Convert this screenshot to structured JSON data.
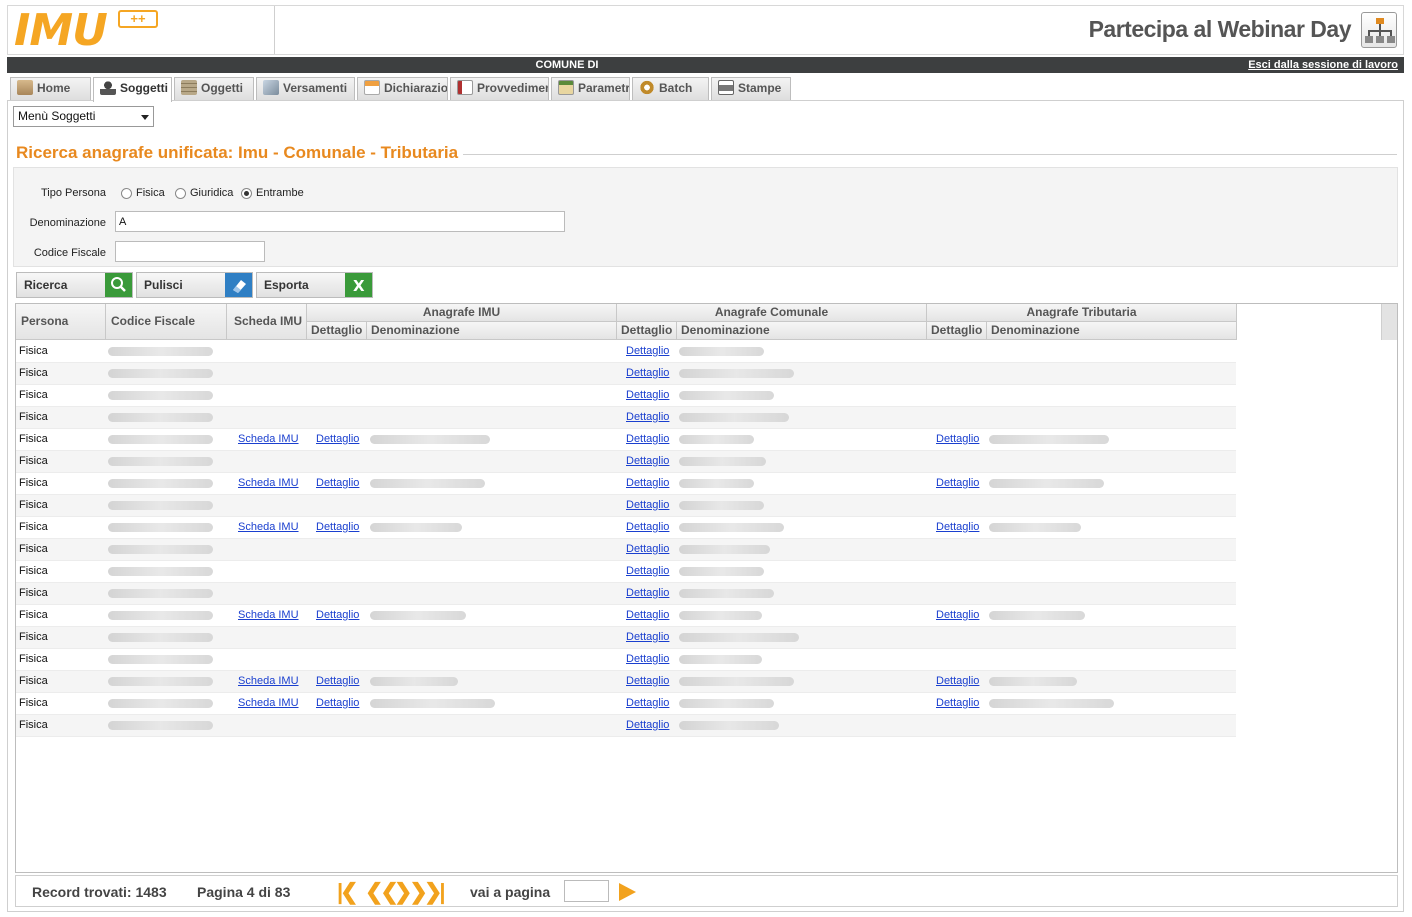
{
  "header": {
    "logo_text": "IMU",
    "logo_badge": "++",
    "webinar_text": "Partecipa al Webinar Day"
  },
  "topbar": {
    "comune": "COMUNE DI",
    "logout": "Esci dalla sessione di lavoro"
  },
  "tabs": [
    {
      "label": "Home",
      "icon": "home-icon",
      "color": "#8a6d3b"
    },
    {
      "label": "Soggetti",
      "icon": "user-icon",
      "color": "#444444"
    },
    {
      "label": "Oggetti",
      "icon": "building-icon",
      "color": "#9a8a6a"
    },
    {
      "label": "Versamenti",
      "icon": "payment-icon",
      "color": "#7b8c9c"
    },
    {
      "label": "Dichiarazio",
      "icon": "declaration-icon",
      "color": "#d9822b"
    },
    {
      "label": "Provvedimen",
      "icon": "document-icon",
      "color": "#b03030"
    },
    {
      "label": "Parametr",
      "icon": "parameters-icon",
      "color": "#c0782a"
    },
    {
      "label": "Batch",
      "icon": "gears-icon",
      "color": "#c08a2a"
    },
    {
      "label": "Stampe",
      "icon": "printer-icon",
      "color": "#666666"
    }
  ],
  "active_tab": "Soggetti",
  "menu": {
    "selected": "Menù Soggetti"
  },
  "section": {
    "title": "Ricerca anagrafe unificata: Imu - Comunale - Tributaria"
  },
  "form": {
    "tipo_persona_label": "Tipo Persona",
    "options": [
      "Fisica",
      "Giuridica",
      "Entrambe"
    ],
    "selected_option": "Entrambe",
    "denominazione_label": "Denominazione",
    "denominazione_value": "A",
    "codice_fiscale_label": "Codice Fiscale",
    "codice_fiscale_value": ""
  },
  "buttons": {
    "ricerca": "Ricerca",
    "pulisci": "Pulisci",
    "esporta": "Esporta"
  },
  "grid": {
    "headers": {
      "persona": "Persona",
      "codice_fiscale": "Codice Fiscale",
      "scheda_imu": "Scheda IMU",
      "anagrafe_imu": "Anagrafe IMU",
      "anagrafe_comunale": "Anagrafe Comunale",
      "anagrafe_tributaria": "Anagrafe Tributaria",
      "dettaglio": "Dettaglio",
      "denominazione": "Denominazione"
    },
    "link_scheda": "Scheda IMU",
    "link_dettaglio": "Dettaglio",
    "rows": [
      {
        "persona": "Fisica",
        "imu": false,
        "trib": false
      },
      {
        "persona": "Fisica",
        "imu": false,
        "trib": false
      },
      {
        "persona": "Fisica",
        "imu": false,
        "trib": false
      },
      {
        "persona": "Fisica",
        "imu": false,
        "trib": false
      },
      {
        "persona": "Fisica",
        "imu": true,
        "trib": true
      },
      {
        "persona": "Fisica",
        "imu": false,
        "trib": false
      },
      {
        "persona": "Fisica",
        "imu": true,
        "trib": true
      },
      {
        "persona": "Fisica",
        "imu": false,
        "trib": false
      },
      {
        "persona": "Fisica",
        "imu": true,
        "trib": true
      },
      {
        "persona": "Fisica",
        "imu": false,
        "trib": false
      },
      {
        "persona": "Fisica",
        "imu": false,
        "trib": false
      },
      {
        "persona": "Fisica",
        "imu": false,
        "trib": false
      },
      {
        "persona": "Fisica",
        "imu": true,
        "trib": true
      },
      {
        "persona": "Fisica",
        "imu": false,
        "trib": false
      },
      {
        "persona": "Fisica",
        "imu": false,
        "trib": false
      },
      {
        "persona": "Fisica",
        "imu": true,
        "trib": true
      },
      {
        "persona": "Fisica",
        "imu": true,
        "trib": true
      },
      {
        "persona": "Fisica",
        "imu": false,
        "trib": false
      }
    ]
  },
  "footer": {
    "record_text": "Record trovati: 1483",
    "page_text": "Pagina 4 di 83",
    "goto_label": "vai a pagina",
    "goto_value": ""
  },
  "colors": {
    "accent": "#e8891f",
    "pager": "#f2a21d",
    "link": "#1a3fcf",
    "topbar": "#3d3f40",
    "search_icon_bg": "#3a9a3a",
    "clear_icon_bg": "#2f7fc4",
    "export_icon_bg": "#3a9a3a"
  }
}
